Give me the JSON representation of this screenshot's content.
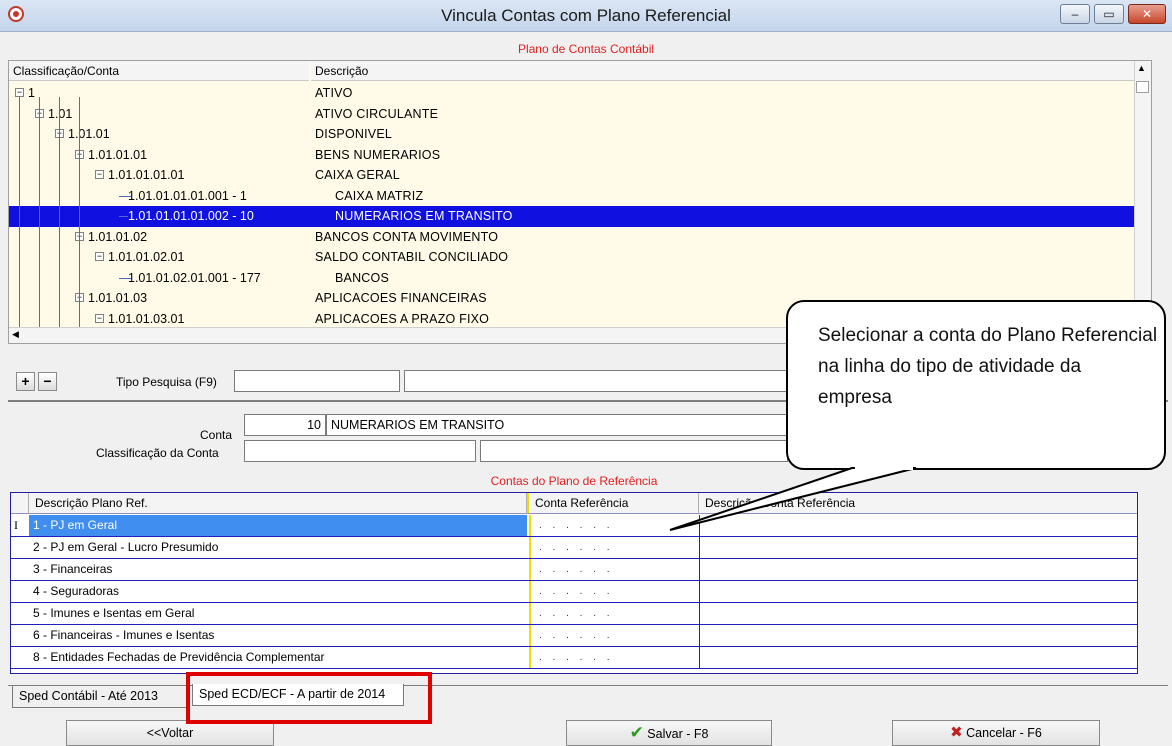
{
  "window": {
    "title": "Vincula Contas com Plano Referencial",
    "buttons": {
      "minimize": "–",
      "maximize": "▭",
      "close": "✕"
    }
  },
  "plano_contas": {
    "header": "Plano de Contas Contábil",
    "columns": [
      "Classificação/Conta",
      "Descrição"
    ],
    "rows": [
      {
        "code": "1",
        "desc": "ATIVO",
        "level": 0,
        "expander": "−"
      },
      {
        "code": "1.01",
        "desc": "ATIVO CIRCULANTE",
        "level": 1,
        "expander": "−"
      },
      {
        "code": "1.01.01",
        "desc": "DISPONIVEL",
        "level": 2,
        "expander": "−"
      },
      {
        "code": "1.01.01.01",
        "desc": "BENS NUMERARIOS",
        "level": 3,
        "expander": "−"
      },
      {
        "code": "1.01.01.01.01",
        "desc": "CAIXA GERAL",
        "level": 4,
        "expander": "−"
      },
      {
        "code": "1.01.01.01.01.001 - 1",
        "desc": "CAIXA MATRIZ",
        "level": 5,
        "expander": ""
      },
      {
        "code": "1.01.01.01.01.002 - 10",
        "desc": "NUMERARIOS EM TRANSITO",
        "level": 5,
        "expander": "",
        "selected": true
      },
      {
        "code": "1.01.01.02",
        "desc": "BANCOS CONTA MOVIMENTO",
        "level": 3,
        "expander": "−"
      },
      {
        "code": "1.01.01.02.01",
        "desc": "SALDO CONTABIL CONCILIADO",
        "level": 4,
        "expander": "−"
      },
      {
        "code": "1.01.01.02.01.001 - 177",
        "desc": "BANCOS",
        "level": 5,
        "expander": ""
      },
      {
        "code": "1.01.01.03",
        "desc": "APLICACOES FINANCEIRAS",
        "level": 3,
        "expander": "−"
      },
      {
        "code": "1.01.01.03.01",
        "desc": "APLICACOES A PRAZO FIXO",
        "level": 4,
        "expander": "−"
      }
    ]
  },
  "toolbar": {
    "add_label": "+",
    "remove_label": "−",
    "tipo_pesquisa_label": "Tipo Pesquisa (F9)"
  },
  "conta": {
    "label": "Conta",
    "number": "10",
    "name": "NUMERARIOS EM TRANSITO",
    "classificacao_label": "Classificação da Conta"
  },
  "referencia": {
    "header": "Contas do Plano de Referência",
    "columns": [
      "Descrição Plano Ref.",
      "Conta Referência",
      "Descrição Conta Referência"
    ],
    "rows": [
      {
        "desc": "1 - PJ em Geral",
        "conta": ". . . . . .",
        "current": true
      },
      {
        "desc": "2 - PJ em Geral - Lucro Presumido",
        "conta": ". . . . . ."
      },
      {
        "desc": "3 - Financeiras",
        "conta": ". . . . . ."
      },
      {
        "desc": "4 - Seguradoras",
        "conta": ". . . . . ."
      },
      {
        "desc": "5 - Imunes e Isentas em Geral",
        "conta": ". . . . . ."
      },
      {
        "desc": "6 - Financeiras - Imunes e Isentas",
        "conta": ". . . . . ."
      },
      {
        "desc": "8 - Entidades Fechadas de Previdência Complementar",
        "conta": ". . . . . ."
      }
    ],
    "row_indicator": "I"
  },
  "tabs": [
    "Sped Contábil - Até 2013",
    "Sped ECD/ECF - A partir de 2014"
  ],
  "buttons": {
    "voltar": "<<Voltar",
    "salvar": "Salvar - F8",
    "cancelar": "Cancelar - F6"
  },
  "callout": {
    "text": "Selecionar a conta do Plano Referencial na linha do tipo de atividade da empresa"
  },
  "colors": {
    "selection": "#1010e0",
    "current_row": "#3f8ef0",
    "section_header": "#e02020",
    "highlight_box": "#e00000"
  }
}
